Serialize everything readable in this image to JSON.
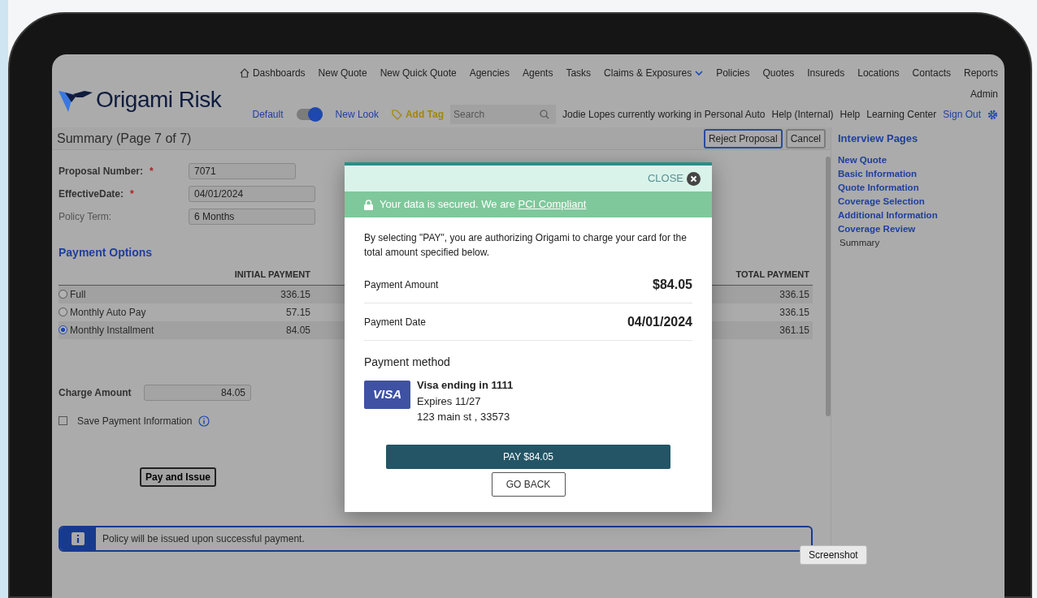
{
  "header": {
    "logo_text": "Origami Risk",
    "nav": [
      {
        "label": "Dashboards",
        "kind": "home"
      },
      {
        "label": "New Quote",
        "kind": "plain"
      },
      {
        "label": "New Quick Quote",
        "kind": "plain"
      },
      {
        "label": "Agencies",
        "kind": "plain"
      },
      {
        "label": "Agents",
        "kind": "plain"
      },
      {
        "label": "Tasks",
        "kind": "plain"
      },
      {
        "label": "Claims & Exposures",
        "kind": "dropdown"
      },
      {
        "label": "Policies",
        "kind": "plain"
      },
      {
        "label": "Quotes",
        "kind": "plain"
      },
      {
        "label": "Insureds",
        "kind": "plain"
      },
      {
        "label": "Locations",
        "kind": "plain"
      },
      {
        "label": "Contacts",
        "kind": "plain"
      },
      {
        "label": "Reports",
        "kind": "plain"
      }
    ],
    "user_menu": "Admin"
  },
  "toolbar": {
    "default_label": "Default",
    "toggle": {
      "on": true
    },
    "new_look_label": "New Look",
    "add_tag": "Add Tag",
    "search": {
      "placeholder": "Search"
    },
    "status": "Jodie Lopes currently working in Personal Auto",
    "links": [
      "Help (Internal)",
      "Help",
      "Learning Center"
    ],
    "sign_out": "Sign Out"
  },
  "page": {
    "title": "Summary (Page 7 of 7)",
    "buttons": [
      "Reject Proposal",
      "Cancel"
    ],
    "fields": [
      {
        "label": "Proposal Number:",
        "required": true,
        "marker": "*",
        "value": "7071"
      },
      {
        "label": "EffectiveDate:",
        "required": true,
        "marker": "*",
        "value": "04/01/2024"
      },
      {
        "label": "Policy Term:",
        "required": false,
        "value": "6 Months"
      }
    ],
    "payment_options": {
      "title": "Payment Options",
      "columns": [
        "INITIAL PAYMENT",
        "TOTAL PAYMENT"
      ],
      "rows": [
        {
          "label": "Full",
          "initial": "336.15",
          "total": "336.15",
          "selected": false
        },
        {
          "label": "Monthly Auto Pay",
          "initial": "57.15",
          "total": "336.15",
          "selected": false
        },
        {
          "label": "Monthly Installment",
          "initial": "84.05",
          "total": "361.15",
          "selected": true
        }
      ]
    },
    "charge": {
      "label": "Charge Amount",
      "value": "84.05"
    },
    "save_payment": {
      "label": "Save Payment Information",
      "checked": false
    },
    "pay_issue_button": "Pay and Issue",
    "info_bar": "Policy will be issued upon successful payment."
  },
  "sidebar": {
    "title": "Interview Pages",
    "items": [
      {
        "label": "New Quote",
        "selected": false
      },
      {
        "label": "Basic Information",
        "selected": false
      },
      {
        "label": "Quote Information",
        "selected": false
      },
      {
        "label": "Coverage Selection",
        "selected": false
      },
      {
        "label": "Additional Information",
        "selected": false
      },
      {
        "label": "Coverage Review",
        "selected": false
      },
      {
        "label": "Summary",
        "selected": true
      }
    ]
  },
  "modal": {
    "close": "CLOSE",
    "secure_text": "Your data is secured. We are ",
    "secure_link": "PCI Compliant",
    "notice": "By selecting \"PAY\", you are authorizing Origami to charge your card for the total amount specified below.",
    "rows": [
      {
        "label": "Payment Amount",
        "value": "$84.05"
      },
      {
        "label": "Payment Date",
        "value": "04/01/2024"
      }
    ],
    "method_title": "Payment method",
    "card": {
      "brand": "VISA",
      "lines": [
        "Visa ending in 1111",
        "Expires 11/27",
        "123 main st , 33573"
      ]
    },
    "pay_button": "PAY $84.05",
    "back_button": "GO BACK"
  },
  "tooltip": "Screenshot"
}
